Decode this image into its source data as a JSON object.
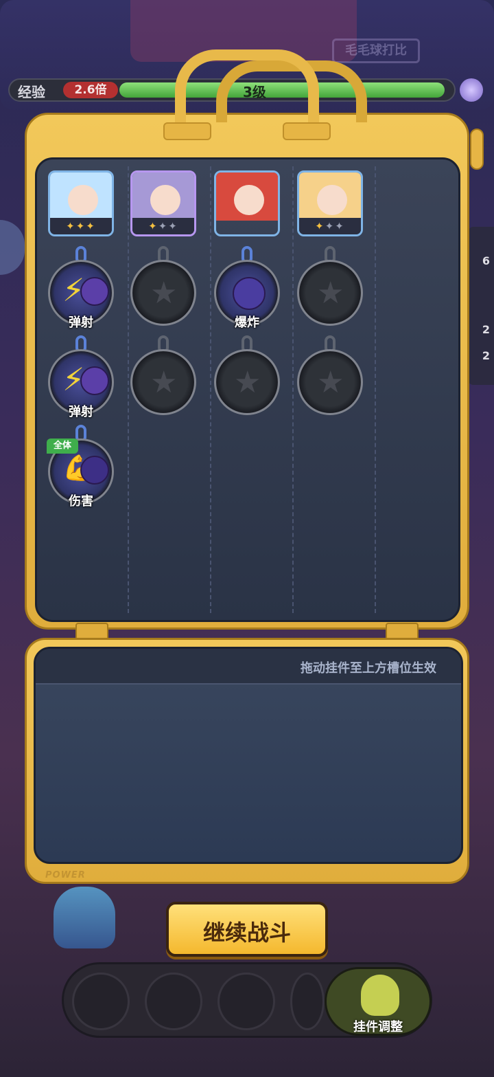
{
  "exp": {
    "label": "经验",
    "multiplier": "2.6倍",
    "level_text": "3级",
    "progress": 0.98
  },
  "bag": {
    "hint": "拖动挂件至上方槽位生效",
    "power_text": "POWER"
  },
  "heroes": [
    {
      "name": "hero-ice-girl",
      "stars": 3,
      "max_stars": 3,
      "bg": "#bfe3ff"
    },
    {
      "name": "hero-robot",
      "stars": 1,
      "max_stars": 3,
      "bg": "#a699d6"
    },
    {
      "name": "hero-red-witch",
      "stars": 0,
      "max_stars": 0,
      "bg": "#d84a3e"
    },
    {
      "name": "hero-straw-hat",
      "stars": 1,
      "max_stars": 3,
      "bg": "#f6d18a"
    }
  ],
  "slots": {
    "col1": [
      {
        "label": "弹射",
        "icon": "lightning-bolt-icon"
      },
      {
        "label": "弹射",
        "icon": "lightning-bolt-icon"
      },
      {
        "label": "伤害",
        "icon": "muscle-monster-icon",
        "badge": "全体"
      }
    ],
    "col3": [
      {
        "label": "爆炸",
        "icon": "bomb-monster-icon"
      }
    ]
  },
  "buttons": {
    "continue": "继续战斗",
    "adjust": "挂件调整"
  },
  "sidebar": {
    "counts": [
      "6",
      "2",
      "2"
    ]
  },
  "bg_sign": "毛毛球打比"
}
